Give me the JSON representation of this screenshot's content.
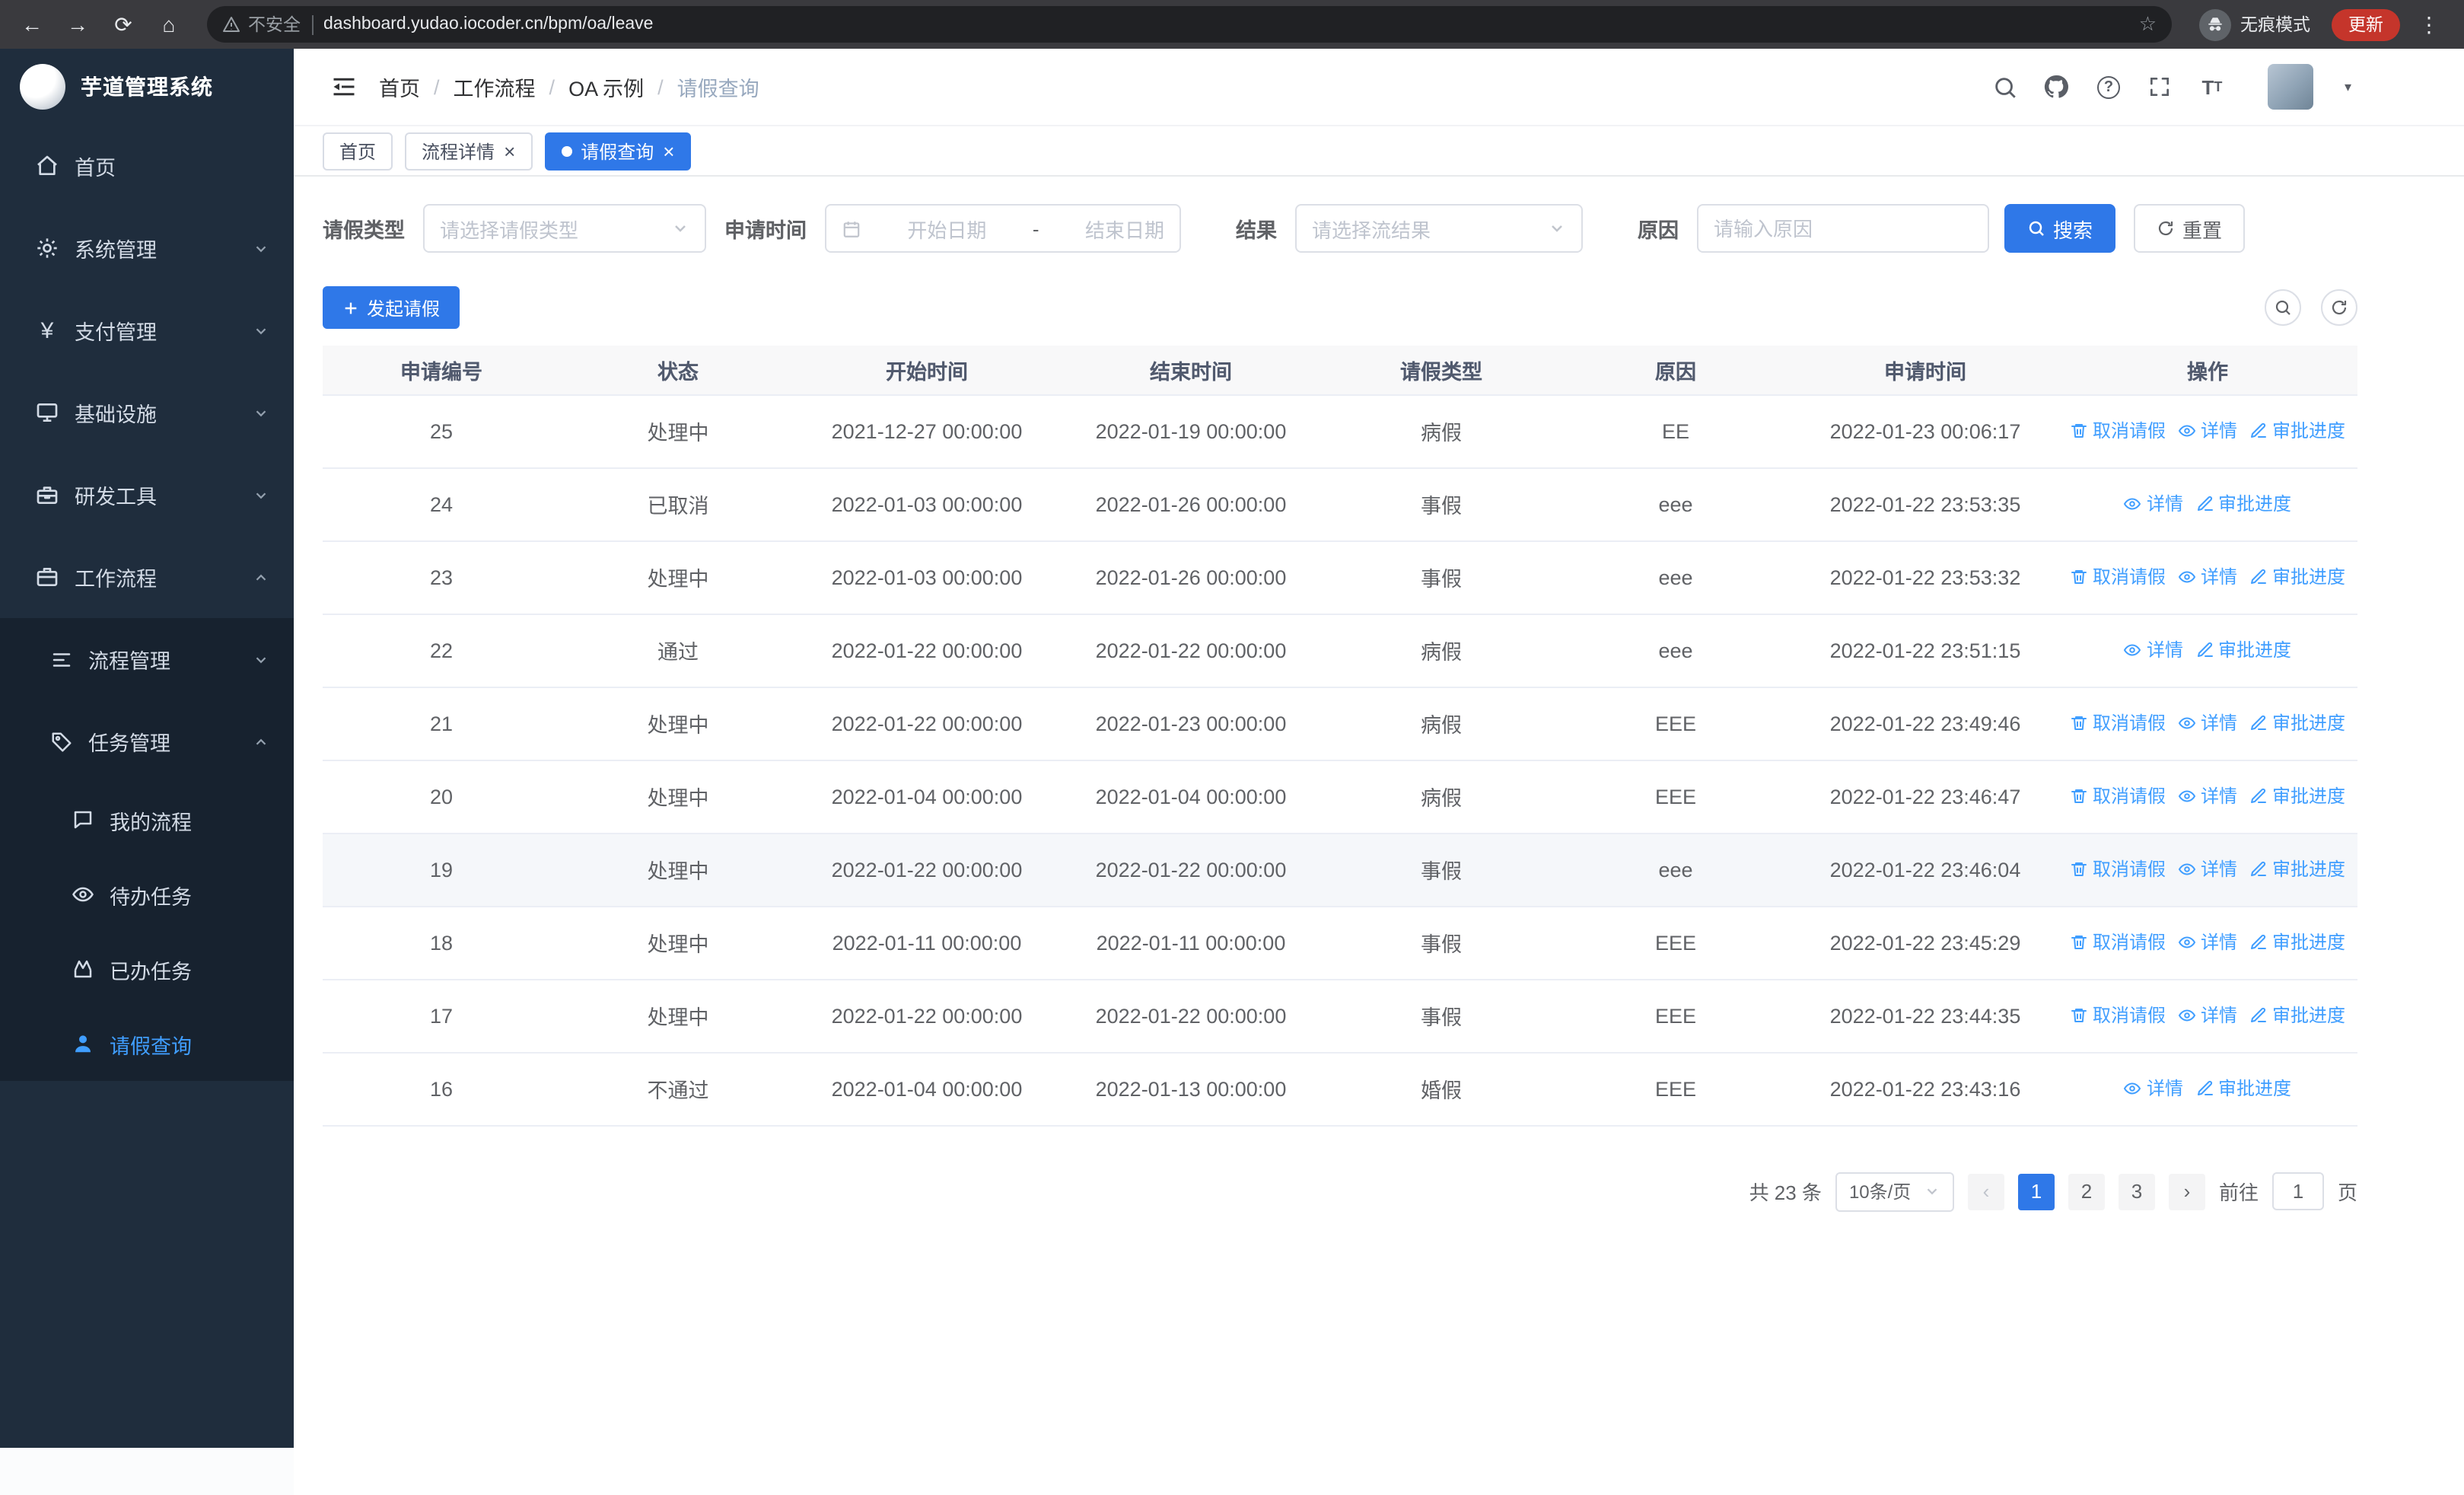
{
  "colors": {
    "primary": "#2f78e8",
    "link": "#409eff",
    "sidebar_bg": "#1f2d3d",
    "sidebar_submenu_bg": "#17222f",
    "sidebar_active_text": "#409eff",
    "update_badge": "#c5352b"
  },
  "browser": {
    "security_label": "不安全",
    "url": "dashboard.yudao.iocoder.cn/bpm/oa/leave",
    "incognito_label": "无痕模式",
    "update_label": "更新"
  },
  "sidebar": {
    "app_title": "芋道管理系统",
    "menu": [
      {
        "label": "首页",
        "icon": "home"
      },
      {
        "label": "系统管理",
        "icon": "gear"
      },
      {
        "label": "支付管理",
        "icon": "yen"
      },
      {
        "label": "基础设施",
        "icon": "monitor"
      },
      {
        "label": "研发工具",
        "icon": "toolbox"
      },
      {
        "label": "工作流程",
        "icon": "briefcase"
      }
    ],
    "workflow_children": [
      {
        "label": "流程管理",
        "icon": "list"
      },
      {
        "label": "任务管理",
        "icon": "tag"
      }
    ],
    "task_children": [
      {
        "label": "我的流程",
        "icon": "chat"
      },
      {
        "label": "待办任务",
        "icon": "eye"
      },
      {
        "label": "已办任务",
        "icon": "check"
      },
      {
        "label": "请假查询",
        "icon": "user",
        "active": true
      }
    ]
  },
  "header": {
    "breadcrumb": [
      "首页",
      "工作流程",
      "OA 示例",
      "请假查询"
    ],
    "icons": [
      "search",
      "github",
      "help",
      "fullscreen",
      "font-size",
      "avatar"
    ]
  },
  "tabs": [
    {
      "label": "首页",
      "closable": false,
      "active": false
    },
    {
      "label": "流程详情",
      "closable": true,
      "active": false
    },
    {
      "label": "请假查询",
      "closable": true,
      "active": true
    }
  ],
  "filters": {
    "leave_type_label": "请假类型",
    "leave_type_placeholder": "请选择请假类型",
    "apply_time_label": "申请时间",
    "start_date_placeholder": "开始日期",
    "date_separator": "-",
    "end_date_placeholder": "结束日期",
    "result_label": "结果",
    "result_placeholder": "请选择流结果",
    "reason_label": "原因",
    "reason_placeholder": "请输入原因",
    "search_button": "搜索",
    "reset_button": "重置"
  },
  "toolbar": {
    "create_button": "发起请假"
  },
  "table": {
    "columns": [
      "申请编号",
      "状态",
      "开始时间",
      "结束时间",
      "请假类型",
      "原因",
      "申请时间",
      "操作"
    ],
    "actions": {
      "cancel": "取消请假",
      "detail": "详情",
      "progress": "审批进度"
    },
    "rows": [
      {
        "id": "25",
        "status": "处理中",
        "start": "2021-12-27 00:00:00",
        "end": "2022-01-19 00:00:00",
        "type": "病假",
        "reason": "EE",
        "applied": "2022-01-23 00:06:17",
        "cancelable": true,
        "highlighted": false
      },
      {
        "id": "24",
        "status": "已取消",
        "start": "2022-01-03 00:00:00",
        "end": "2022-01-26 00:00:00",
        "type": "事假",
        "reason": "eee",
        "applied": "2022-01-22 23:53:35",
        "cancelable": false,
        "highlighted": false
      },
      {
        "id": "23",
        "status": "处理中",
        "start": "2022-01-03 00:00:00",
        "end": "2022-01-26 00:00:00",
        "type": "事假",
        "reason": "eee",
        "applied": "2022-01-22 23:53:32",
        "cancelable": true,
        "highlighted": false
      },
      {
        "id": "22",
        "status": "通过",
        "start": "2022-01-22 00:00:00",
        "end": "2022-01-22 00:00:00",
        "type": "病假",
        "reason": "eee",
        "applied": "2022-01-22 23:51:15",
        "cancelable": false,
        "highlighted": false
      },
      {
        "id": "21",
        "status": "处理中",
        "start": "2022-01-22 00:00:00",
        "end": "2022-01-23 00:00:00",
        "type": "病假",
        "reason": "EEE",
        "applied": "2022-01-22 23:49:46",
        "cancelable": true,
        "highlighted": false
      },
      {
        "id": "20",
        "status": "处理中",
        "start": "2022-01-04 00:00:00",
        "end": "2022-01-04 00:00:00",
        "type": "病假",
        "reason": "EEE",
        "applied": "2022-01-22 23:46:47",
        "cancelable": true,
        "highlighted": false
      },
      {
        "id": "19",
        "status": "处理中",
        "start": "2022-01-22 00:00:00",
        "end": "2022-01-22 00:00:00",
        "type": "事假",
        "reason": "eee",
        "applied": "2022-01-22 23:46:04",
        "cancelable": true,
        "highlighted": true
      },
      {
        "id": "18",
        "status": "处理中",
        "start": "2022-01-11 00:00:00",
        "end": "2022-01-11 00:00:00",
        "type": "事假",
        "reason": "EEE",
        "applied": "2022-01-22 23:45:29",
        "cancelable": true,
        "highlighted": false
      },
      {
        "id": "17",
        "status": "处理中",
        "start": "2022-01-22 00:00:00",
        "end": "2022-01-22 00:00:00",
        "type": "事假",
        "reason": "EEE",
        "applied": "2022-01-22 23:44:35",
        "cancelable": true,
        "highlighted": false
      },
      {
        "id": "16",
        "status": "不通过",
        "start": "2022-01-04 00:00:00",
        "end": "2022-01-13 00:00:00",
        "type": "婚假",
        "reason": "EEE",
        "applied": "2022-01-22 23:43:16",
        "cancelable": false,
        "highlighted": false
      }
    ]
  },
  "pagination": {
    "total": "共 23 条",
    "page_size": "10条/页",
    "pages": [
      "1",
      "2",
      "3"
    ],
    "active_page": "1",
    "goto_label": "前往",
    "goto_value": "1",
    "page_unit": "页"
  }
}
